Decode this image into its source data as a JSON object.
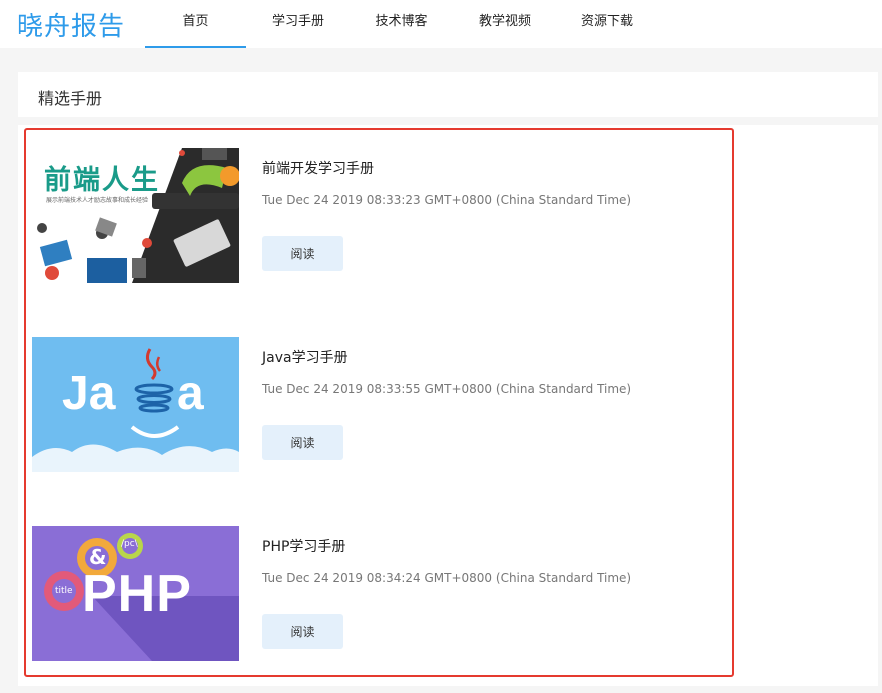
{
  "header": {
    "logo": "晓舟报告",
    "brand_color": "#2e9bea",
    "nav": [
      {
        "label": "首页",
        "active": true
      },
      {
        "label": "学习手册",
        "active": false
      },
      {
        "label": "技术博客",
        "active": false
      },
      {
        "label": "教学视频",
        "active": false
      },
      {
        "label": "资源下载",
        "active": false
      }
    ]
  },
  "section": {
    "title": "精选手册"
  },
  "highlight_color": "#e53a2f",
  "cards": [
    {
      "title": "前端开发学习手册",
      "time": "Tue Dec 24 2019 08:33:23 GMT+0800 (China Standard Time)",
      "button": "阅读",
      "thumb": {
        "heading": "前端人生",
        "subtitle": "展示前端技术人才励志故事和成长经验",
        "icon": "frontend-desk-illustration"
      }
    },
    {
      "title": "Java学习手册",
      "time": "Tue Dec 24 2019 08:33:55 GMT+0800 (China Standard Time)",
      "button": "阅读",
      "thumb": {
        "icon": "java-coffee-logo"
      }
    },
    {
      "title": "PHP学习手册",
      "time": "Tue Dec 24 2019 08:34:24 GMT+0800 (China Standard Time)",
      "button": "阅读",
      "thumb": {
        "heading": "PHP",
        "gear1": "&",
        "gear2": "/pc\\",
        "gear3": "title",
        "icon": "php-gears-logo"
      }
    }
  ]
}
